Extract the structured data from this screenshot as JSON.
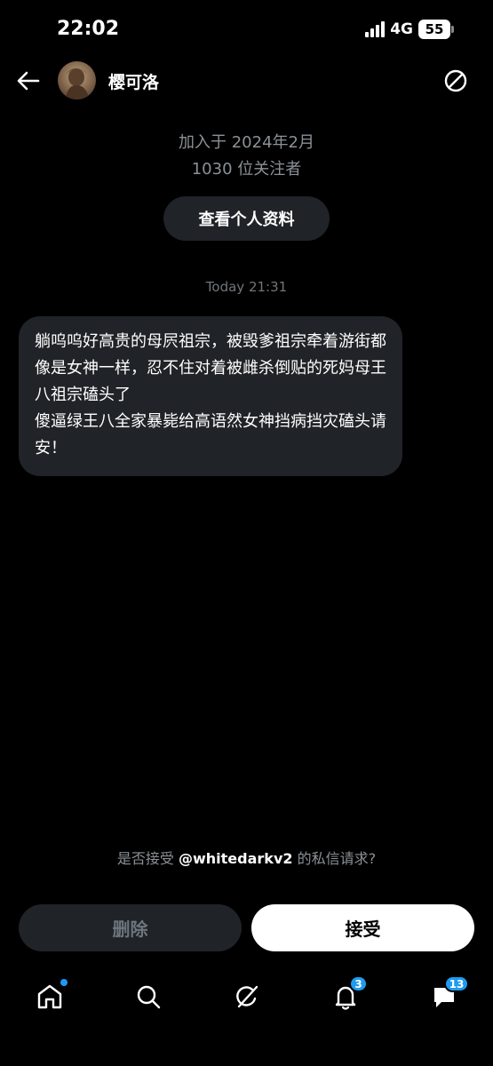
{
  "status_bar": {
    "time": "22:02",
    "network": "4G",
    "battery": "55"
  },
  "header": {
    "user_name": "樱可洛"
  },
  "profile": {
    "joined": "加入于 2024年2月",
    "followers": "1030 位关注者",
    "view_profile_label": "查看个人资料"
  },
  "conversation": {
    "timestamp": "Today 21:31",
    "message": "躺呜呜好高贵的母屄祖宗，被毁爹祖宗牵着游街都像是女神一样，忍不住对着被雌杀倒贴的死妈母王八祖宗磕头了\n傻逼绿王八全家暴毙给高语然女神挡病挡灾磕头请安！"
  },
  "request": {
    "prefix": "是否接受 ",
    "handle": "@whitedarkv2",
    "suffix": " 的私信请求?"
  },
  "actions": {
    "delete_label": "删除",
    "accept_label": "接受"
  },
  "bottom_nav": {
    "items": [
      "home-icon",
      "search-icon",
      "grok-icon",
      "notifications-icon",
      "messages-icon"
    ],
    "notifications_badge": "3",
    "messages_badge": "13"
  },
  "colors": {
    "background": "#000000",
    "bubble": "#202327",
    "accent": "#1d9bf0",
    "muted": "#8b9196"
  }
}
